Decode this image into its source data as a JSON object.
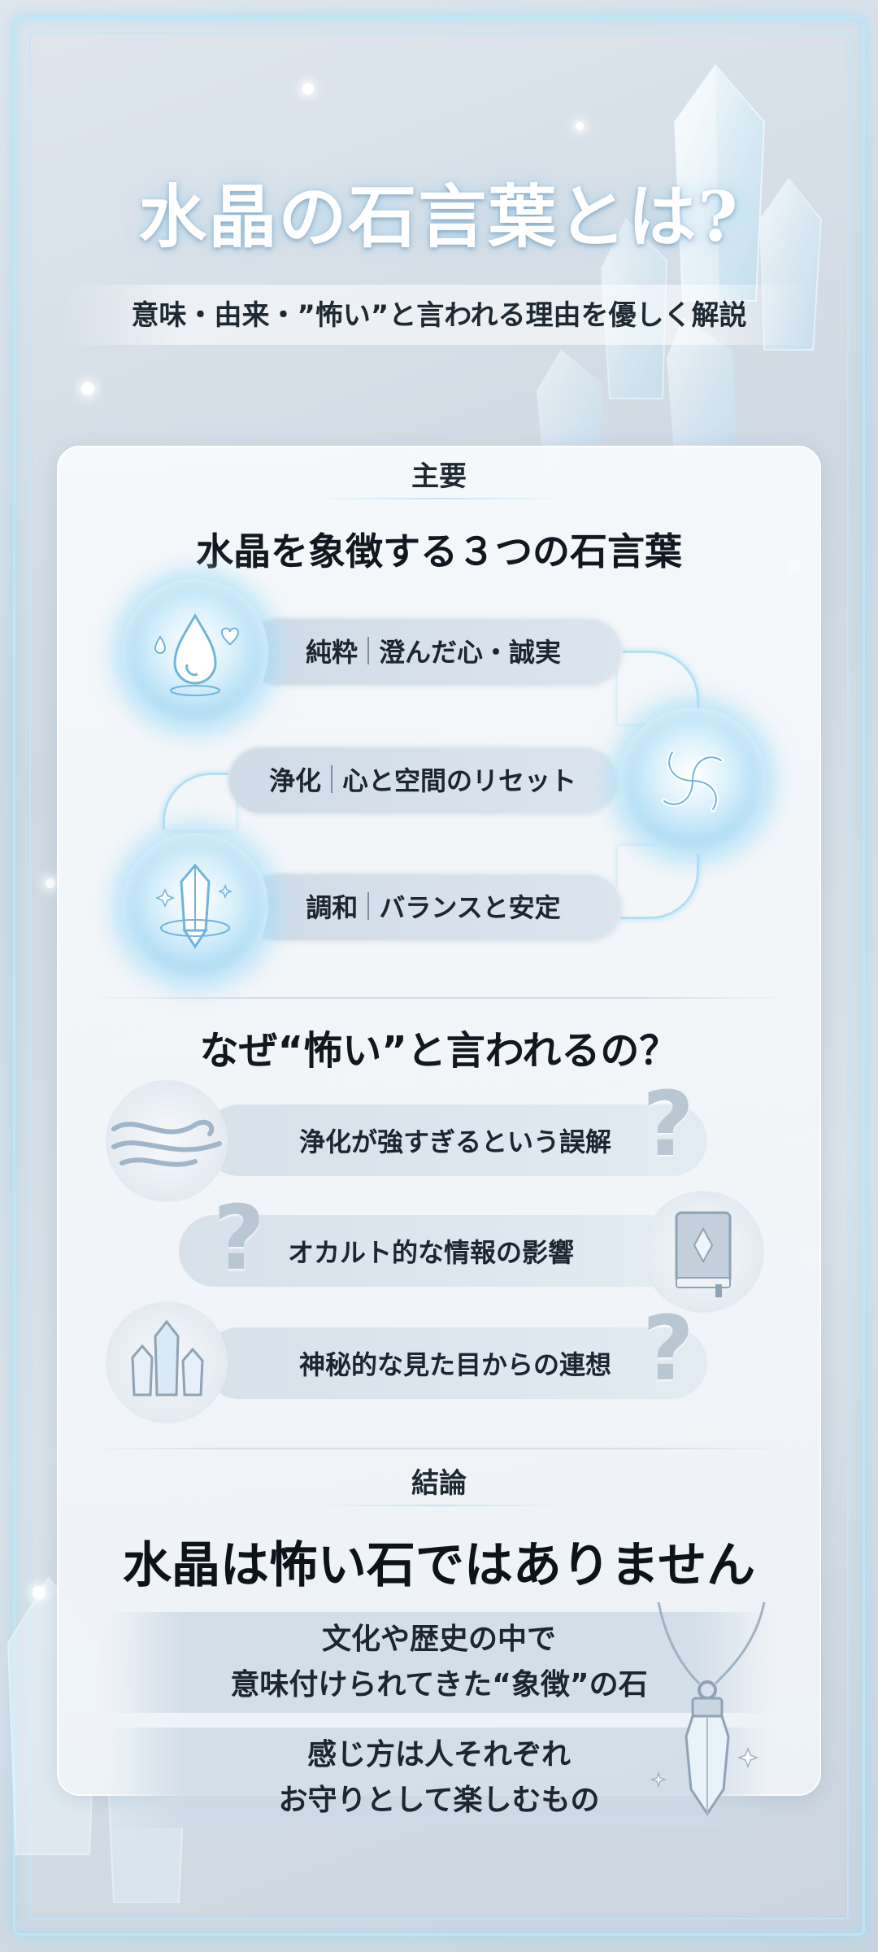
{
  "header": {
    "title": "水晶の石言葉とは?",
    "subtitle": "意味・由来・”怖い”と言われる理由を優しく解説"
  },
  "summary": {
    "label": "主要",
    "heading": "水晶を象徴する３つの石言葉",
    "items": [
      {
        "name": "純粋",
        "meaning": "澄んだ心・誠実",
        "icon": "water-drop-heart-icon"
      },
      {
        "name": "浄化",
        "meaning": "心と空間のリセット",
        "icon": "swirl-icon"
      },
      {
        "name": "調和",
        "meaning": "バランスと安定",
        "icon": "crystal-icon"
      }
    ]
  },
  "why": {
    "heading": "なぜ“怖い”と言われるの？",
    "items": [
      {
        "text": "浄化が強すぎるという誤解",
        "icon": "wind-icon"
      },
      {
        "text": "オカルト的な情報の影響",
        "icon": "book-icon"
      },
      {
        "text": "神秘的な見た目からの連想",
        "icon": "crystal-cluster-icon"
      }
    ]
  },
  "conclusion": {
    "label": "結論",
    "statement": "水晶は怖い石ではありません",
    "line1a": "文化や歴史の中で",
    "line1b": "意味付けられてきた“象徴”の石",
    "line2a": "感じ方は人それぞれ",
    "line2b": "お守りとして楽しむもの"
  },
  "colors": {
    "glow": "#a9d9f2",
    "frame": "#bfe6f7",
    "pill": "#cddae6"
  }
}
